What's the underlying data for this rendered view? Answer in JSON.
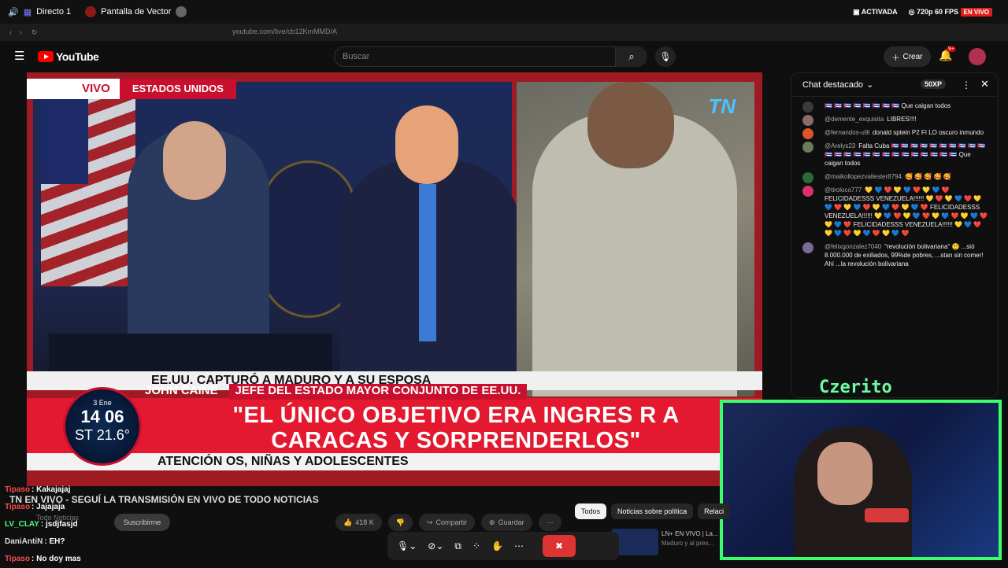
{
  "obs": {
    "tab1": "Directo 1",
    "tab2": "Pantalla de Vector",
    "status_active": "ACTIVADA",
    "quality": "720p 60 FPS",
    "live": "EN VIVO"
  },
  "browser": {
    "url": "youtube.com/live/cb12KmMMD/A"
  },
  "youtube": {
    "logo": "YouTube",
    "search_placeholder": "Buscar",
    "create": "Crear",
    "notif_count": "9+"
  },
  "video": {
    "vivo": "VIVO",
    "country": "ESTADOS UNIDOS",
    "channel_logo": "TN",
    "headline": "EE.UU. CAPTURÓ A MADURO Y A SU ESPOSA",
    "speaker_name": "JOHN CAINE",
    "speaker_role": "JEFE DEL ESTADO MAYOR CONJUNTO DE EE.UU.",
    "quote": "\"EL ÚNICO OBJETIVO ERA INGRES   R A CARACAS Y SORPRENDERLOS\"",
    "ticker": "ATENCIÓN   OS, NIÑAS Y ADOLESCENTES",
    "clock_date": "3 Ene",
    "clock_time": "14 06",
    "clock_temp": "ST 21.6°"
  },
  "chat": {
    "title": "Chat destacado",
    "xp": "50XP",
    "messages": [
      {
        "user": "",
        "text": "🇨🇺 🇨🇺 🇨🇺 🇨🇺 🇨🇺 🇨🇺 🇨🇺 🇨🇺 Que caigan todos",
        "color": "#3a3a3a"
      },
      {
        "user": "@demente_exquisita",
        "text": "LIBRES!!!!",
        "color": "#8a6a6a"
      },
      {
        "user": "@fernandos-u9l",
        "text": "donald sptein P2 FI LO oscuro inmundo",
        "color": "#e0542a"
      },
      {
        "user": "@Arelys23",
        "text": "Falta Cuba 🇨🇺 🇨🇺 🇨🇺 🇨🇺 🇨🇺 🇨🇺 🇨🇺 🇨🇺 🇨🇺 🇨🇺 🇨🇺 🇨🇺 🇨🇺 🇨🇺 🇨🇺 🇨🇺 🇨🇺 🇨🇺 🇨🇺 🇨🇺 🇨🇺 🇨🇺 🇨🇺 🇨🇺 Que caigan todos",
        "color": "#6a7a5a"
      },
      {
        "user": "@maikollopezvallester8794",
        "text": "🥰 🥰 🥰 🥰 🥰",
        "color": "#2a6a3a"
      },
      {
        "user": "@tiroloco777",
        "text": "💛 💙 ❤️ 💛 💙 ❤️ 💛 💙 ❤️ FELICIDADESSS VENEZUELA!!!!!! 💛 ❤️ 💛 💙 ❤️ 💛 💙 ❤️ 💛 💙 ❤️ 💛 💙 ❤️ 💛 💙 ❤️ FELICIDADESSS VENEZUELA!!!!!! 💛 💙 ❤️ 💛 💙 ❤️ 💛 💙 ❤️ 💛 💙 ❤️ 💛 💙 ❤️ FELICIDADESSS VENEZUELA!!!!!! 💛 💙 ❤️ 💛 💙 ❤️ 💛 💙 ❤️ 💛 💙 ❤️",
        "color": "#d8326e"
      },
      {
        "user": "@felixgonzalez7040",
        "text": "\"revolución bolivariana\" 🤨 ...sió 8.000.000 de exiliados, 99%de pobres, ...stan sin comer! Ahí ...la revolución bolivariana",
        "color": "#7a6a9a"
      }
    ]
  },
  "streamer_name": "Czerito",
  "below_video": {
    "title": "TN EN VIVO - SEGUÍ LA TRANSMISIÓN EN VIVO DE TODO NOTICIAS",
    "channel": "Todo Noticias",
    "subscribe": "Suscribirme",
    "likes": "418 K",
    "share": "Compartir",
    "save": "Guardar"
  },
  "chips": [
    "Todos",
    "Noticias sobre política",
    "Relaci"
  ],
  "suggestion": {
    "title": "LN+ EN VIVO | La...",
    "sub": "Maduro y al pres..."
  },
  "twitch_chat": [
    {
      "name": "Tipaso",
      "text": "Kakajajaj",
      "color": "#ff4d4d"
    },
    {
      "name": "Tipaso",
      "text": "Jajajaja",
      "color": "#ff4d4d"
    },
    {
      "name": "LV_CLAY",
      "text": "jsdjfasjd",
      "color": "#4dff7a"
    },
    {
      "name": "DaniAntiN",
      "text": "EH?",
      "color": "#dddddd"
    },
    {
      "name": "Tipaso",
      "text": "No doy mas",
      "color": "#ff4d4d"
    }
  ]
}
